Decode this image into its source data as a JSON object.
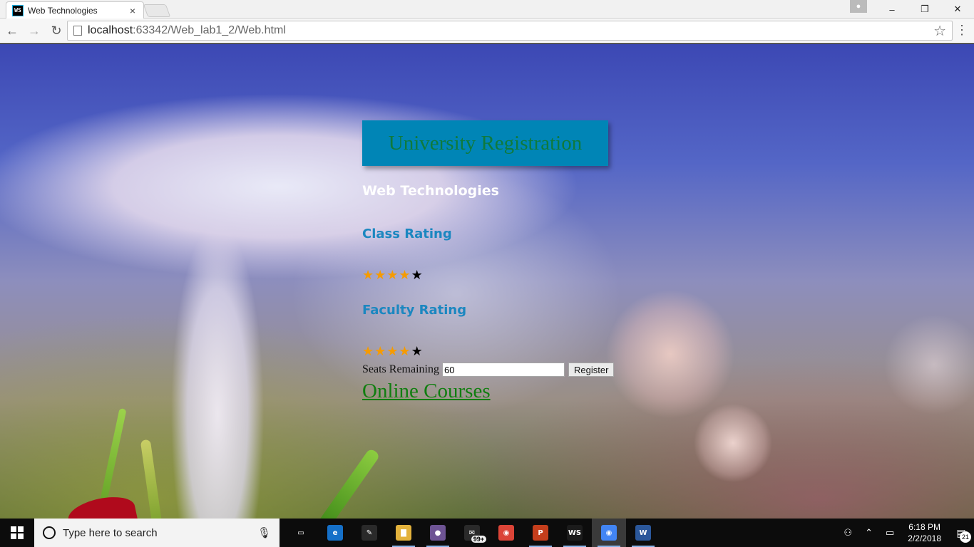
{
  "browser": {
    "tab_title": "Web Technologies",
    "tab_favicon": "WS",
    "tab_close": "×",
    "url_host": "localhost",
    "url_path": ":63342/Web_lab1_2/Web.html",
    "icons": [
      "back-arrow-icon",
      "forward-arrow-icon",
      "reload-icon",
      "page-icon",
      "bookmark-star-icon",
      "menu-icon"
    ]
  },
  "window": {
    "minimize": "–",
    "restore": "❐",
    "close": "✕"
  },
  "page": {
    "banner_title": "University Registration",
    "subject": "Web Technologies",
    "class_rating_label": "Class Rating",
    "class_rating_stars": 4,
    "faculty_rating_label": "Faculty Rating",
    "faculty_rating_stars": 4,
    "max_stars": 5,
    "seats_label": "Seats Remaining",
    "seats_value": "60",
    "register_label": "Register",
    "online_courses_label": "Online Courses",
    "colors": {
      "banner_bg": "#0085b6",
      "banner_text": "#0f7a3c",
      "rating_heading": "#1b87c0",
      "star_filled": "#f59b00",
      "star_empty": "#000000",
      "link": "#107e10"
    }
  },
  "taskbar": {
    "search_placeholder": "Type here to search",
    "apps": [
      {
        "name": "task-view",
        "glyph": "▭"
      },
      {
        "name": "edge",
        "glyph": "e"
      },
      {
        "name": "paint",
        "glyph": "✎"
      },
      {
        "name": "file-explorer",
        "glyph": "▇"
      },
      {
        "name": "github-desktop",
        "glyph": "●"
      },
      {
        "name": "mail",
        "glyph": "✉",
        "badge": "99+"
      },
      {
        "name": "chrome",
        "glyph": "◉"
      },
      {
        "name": "powerpoint",
        "glyph": "P"
      },
      {
        "name": "webstorm",
        "glyph": "WS"
      },
      {
        "name": "chrome-active",
        "glyph": "◉"
      },
      {
        "name": "word",
        "glyph": "W"
      }
    ],
    "clock_time": "6:18 PM",
    "clock_date": "2/2/2018",
    "notification_count": "21"
  }
}
